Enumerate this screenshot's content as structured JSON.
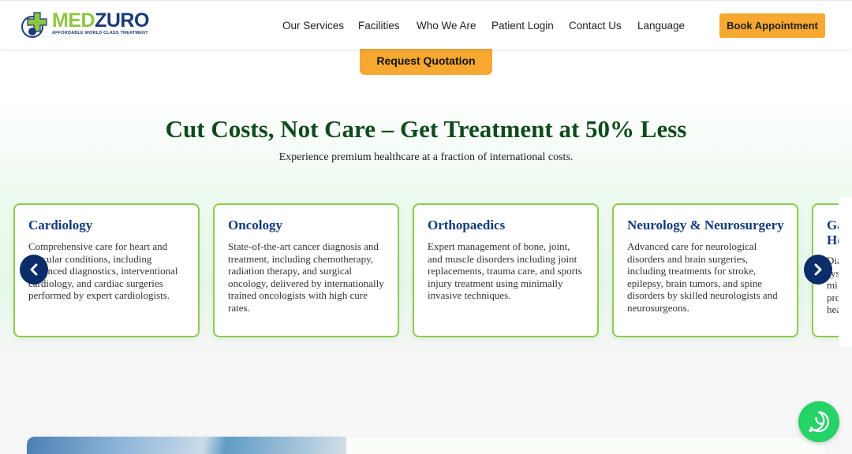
{
  "brand": {
    "name_part1": "MED",
    "name_part2": "ZURO",
    "tagline": "AFFORDABLE WORLD CLASS TREATMENT",
    "colors": {
      "green": "#8dc63f",
      "navy": "#1a3a7a",
      "orange": "#f6a830"
    }
  },
  "nav": {
    "items": [
      {
        "label": "Our Services"
      },
      {
        "label": "Facilities"
      },
      {
        "label": "Who We Are"
      },
      {
        "label": "Patient Login"
      },
      {
        "label": "Contact Us"
      },
      {
        "label": "Language"
      }
    ],
    "cta_label": "Book Appointment"
  },
  "hero": {
    "quote_label": "Request Quotation",
    "title": "Cut Costs, Not Care – Get Treatment at 50% Less",
    "subtitle": "Experience premium healthcare at a fraction of international costs."
  },
  "carousel": {
    "prev_icon": "chevron-left-icon",
    "next_icon": "chevron-right-icon",
    "cards": [
      {
        "title": "Cardiology",
        "text": "Comprehensive care for heart and vascular conditions, including advanced diagnostics, interventional cardiology, and cardiac surgeries performed by expert cardiologists."
      },
      {
        "title": "Oncology",
        "text": "State-of-the-art cancer diagnosis and treatment, including chemotherapy, radiation therapy, and surgical oncology, delivered by internationally trained oncologists with high cure rates."
      },
      {
        "title": "Orthopaedics",
        "text": "Expert management of bone, joint, and muscle disorders including joint replacements, trauma care, and sports injury treatment using minimally invasive techniques."
      },
      {
        "title": "Neurology & Neurosurgery",
        "text": "Advanced care for neurological disorders and brain surgeries, including treatments for stroke, epilepsy, brain tumors, and spine disorders by skilled neurologists and neurosurgeons."
      },
      {
        "title": "Ga Ho",
        "text": "Dia sys mi pro hea"
      }
    ]
  },
  "whatsapp": {
    "icon": "whatsapp-icon",
    "color": "#25d366"
  }
}
